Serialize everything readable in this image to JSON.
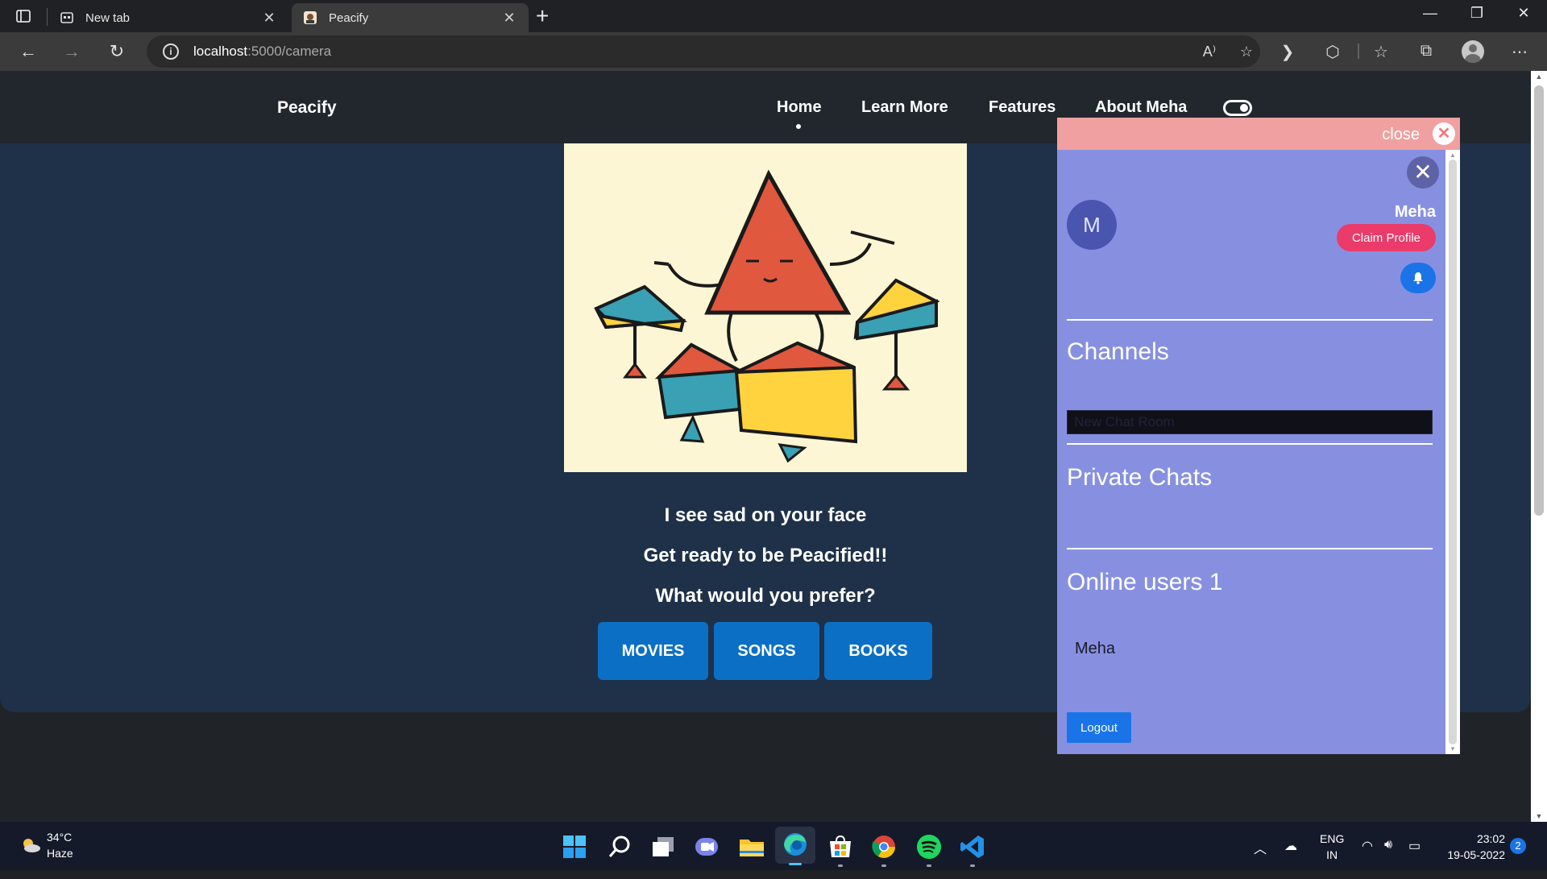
{
  "browser": {
    "tabs": [
      {
        "title": "New tab",
        "active": false
      },
      {
        "title": "Peacify",
        "active": true
      }
    ],
    "address": {
      "host": "localhost",
      "path": ":5000/camera"
    }
  },
  "site": {
    "brand": "Peacify",
    "nav": [
      "Home",
      "Learn More",
      "Features",
      "About Meha"
    ],
    "active_nav": "Home",
    "messages": [
      "I see sad on your face",
      "Get ready to be Peacified!!",
      "What would you prefer?"
    ],
    "choices": [
      "MOVIES",
      "SONGS",
      "BOOKS"
    ]
  },
  "chat": {
    "close_label": "close",
    "avatar_letter": "M",
    "user_name": "Meha",
    "claim_label": "Claim Profile",
    "channels_title": "Channels",
    "new_room_placeholder": "New Chat Room",
    "private_title": "Private Chats",
    "online_title": "Online users 1",
    "online_users": [
      "Meha"
    ],
    "logout_label": "Logout"
  },
  "taskbar": {
    "weather_temp": "34°C",
    "weather_desc": "Haze",
    "lang_line1": "ENG",
    "lang_line2": "IN",
    "time": "23:02",
    "date": "19-05-2022",
    "notifications": "2"
  },
  "colors": {
    "page_bg": "#1f3148",
    "nav_bg": "#21272d",
    "chat_bg": "#8790e0",
    "chat_header": "#f0a0a0",
    "button_blue": "#0b6fc6",
    "claim_pink": "#ea3b6a"
  }
}
